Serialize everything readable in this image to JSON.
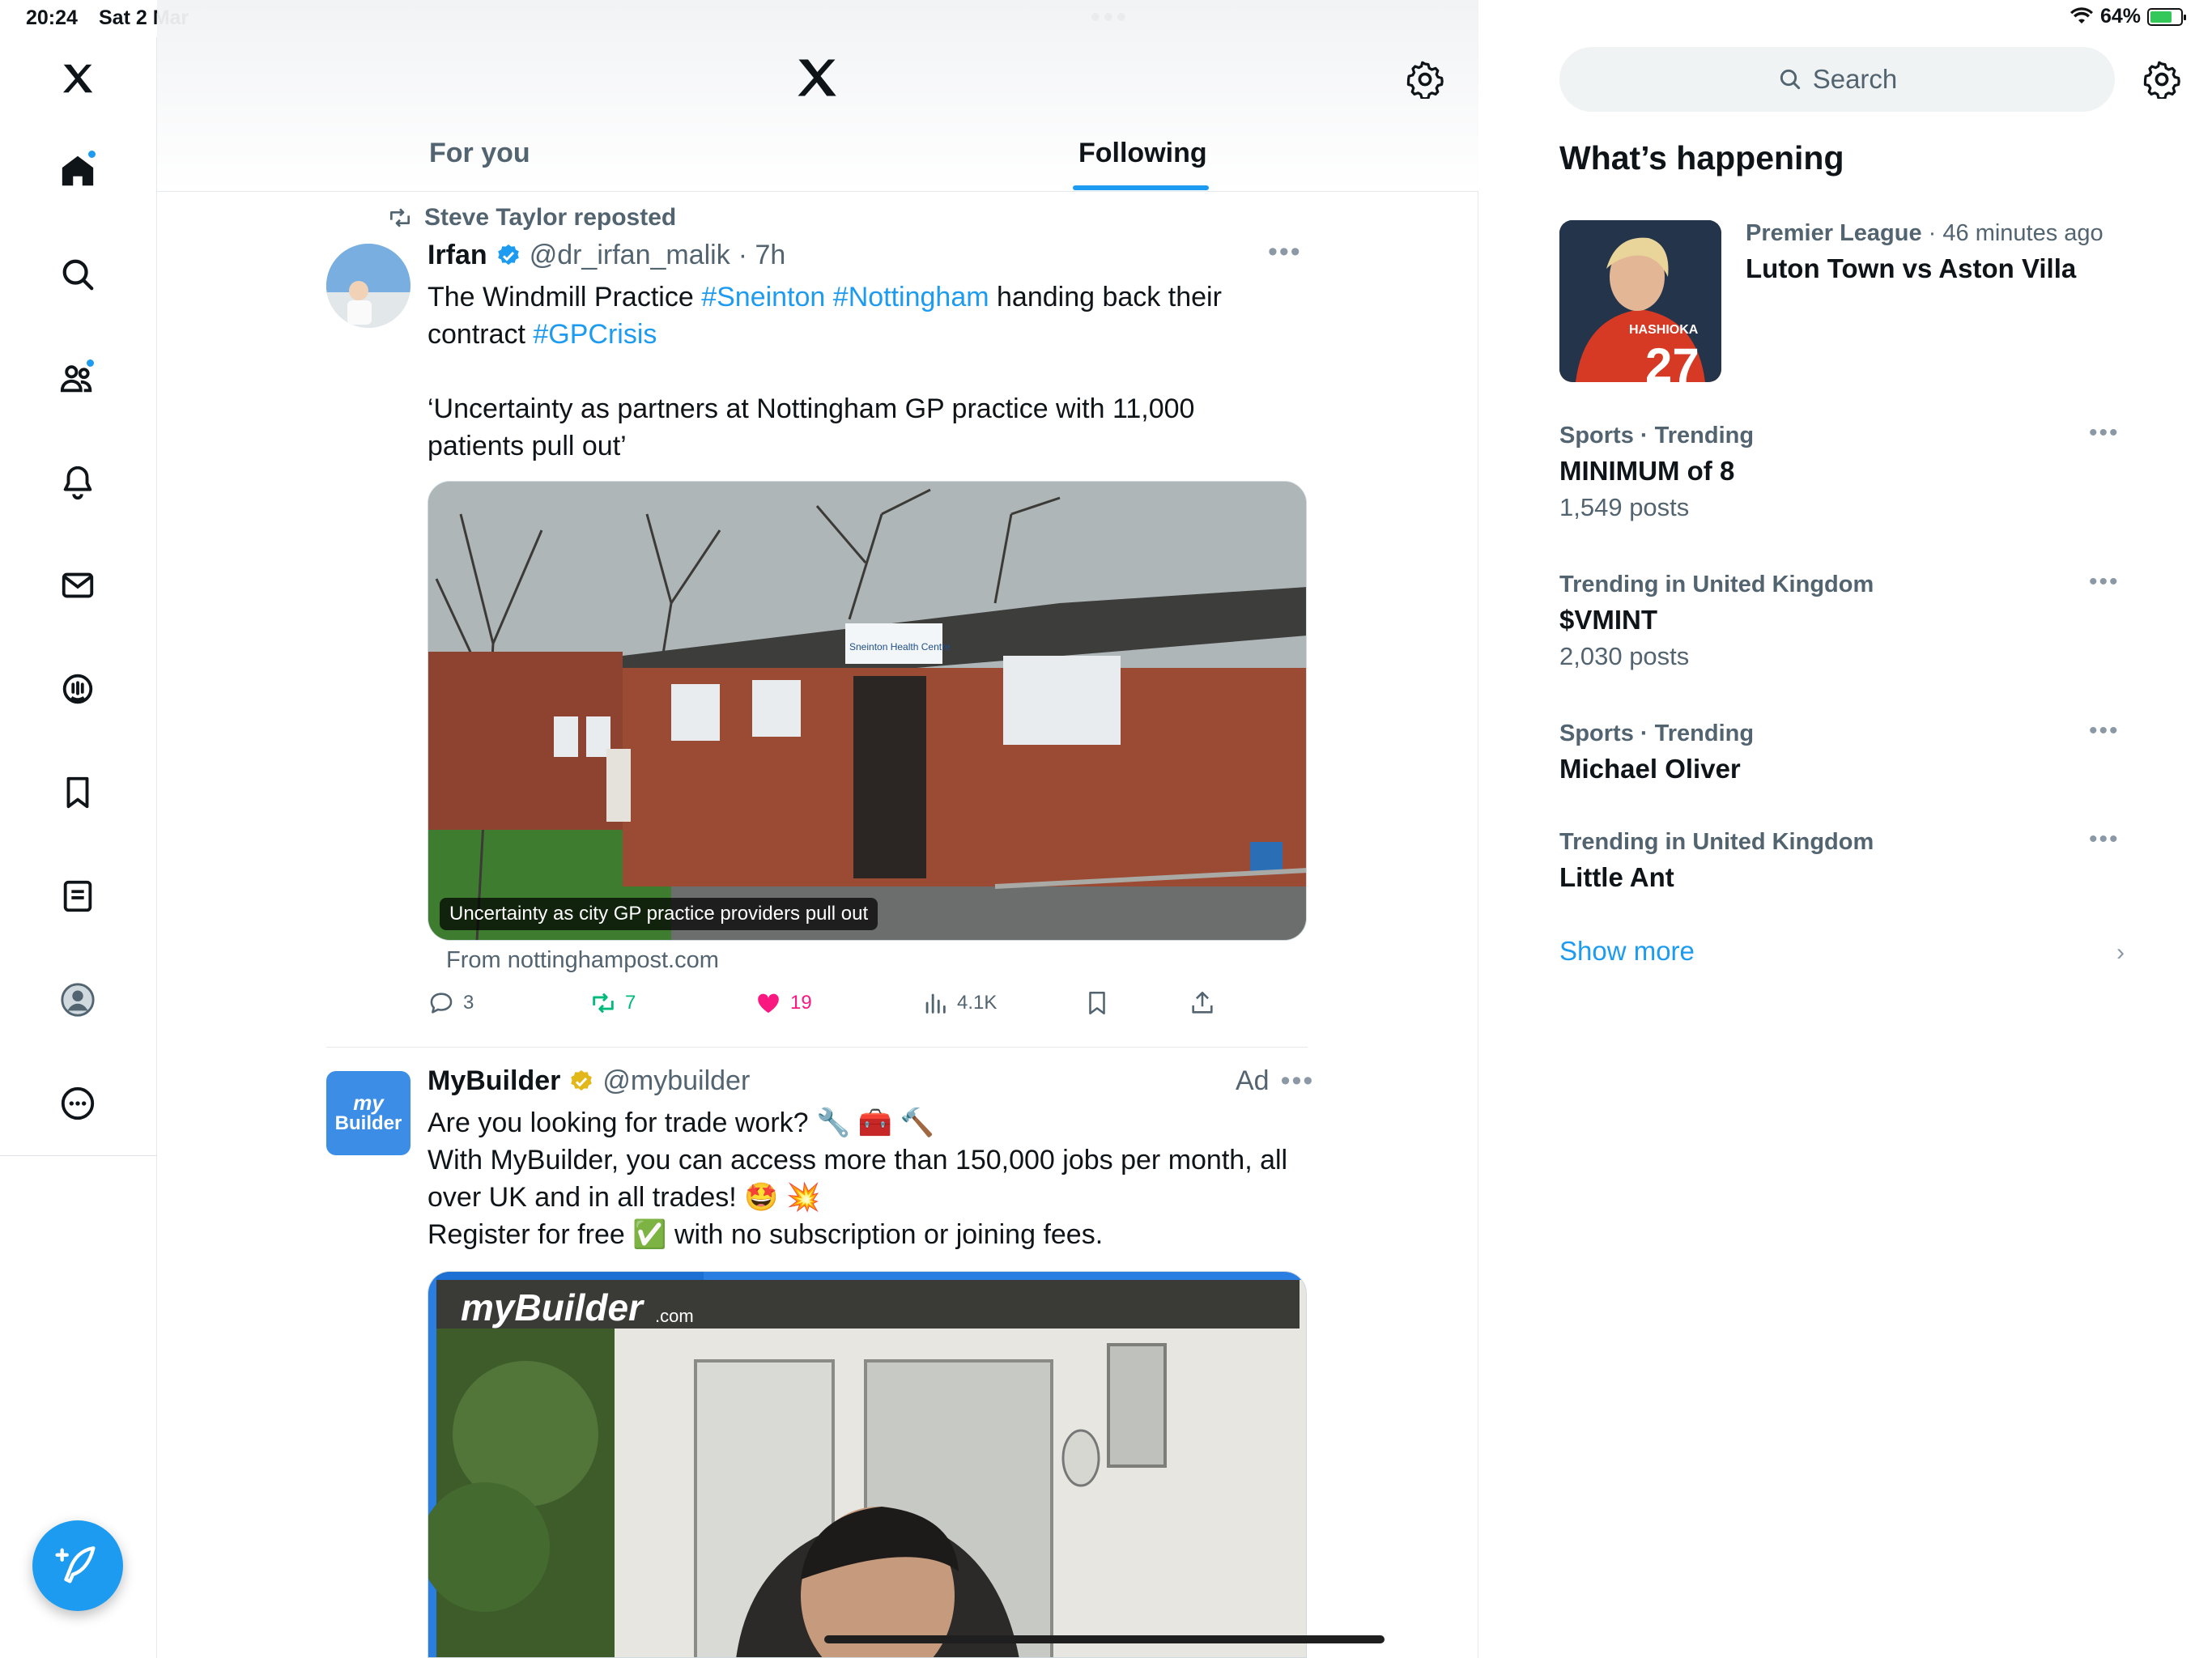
{
  "status_bar": {
    "time": "20:24",
    "date": "Sat 2 Mar",
    "battery": "64%",
    "battery_level": 0.64
  },
  "header": {
    "tabs": [
      {
        "label": "For you",
        "active": false
      },
      {
        "label": "Following",
        "active": true
      }
    ]
  },
  "tweet1": {
    "repost_label": "Steve Taylor reposted",
    "name": "Irfan",
    "handle": "@dr_irfan_malik",
    "time": "· 7h",
    "text_a": "The Windmill Practice ",
    "tag1": "#Sneinton",
    "tag2": "#Nottingham",
    "text_b": " handing back their contract ",
    "tag3": "#GPCrisis",
    "quote": "‘Uncertainty as partners at Nottingham GP practice with 11,000 patients pull out’",
    "media_caption": "Uncertainty as city GP practice providers pull out",
    "sign_text": "Sneinton Health Centre",
    "source": "From nottinghampost.com",
    "stats": {
      "replies": "3",
      "reposts": "7",
      "likes": "19",
      "views": "4.1K"
    }
  },
  "tweet2": {
    "name": "MyBuilder",
    "handle": "@mybuilder",
    "ad_label": "Ad",
    "avatar_line1": "my",
    "avatar_line2": "Builder",
    "line1": "Are you looking for trade work? 🔧 🧰 🔨",
    "line2": "With MyBuilder, you can access more than 150,000 jobs per month, all over UK and in all trades! 🤩 💥",
    "line3": "Register for free ✅ with no subscription or joining fees.",
    "media_logo": "myBuilder",
    "media_logo_suffix": ".com"
  },
  "right": {
    "search_placeholder": "Search",
    "title": "What’s happening",
    "featured": {
      "category": "Premier League",
      "time": " · 46 minutes ago",
      "title": "Luton Town vs Aston Villa",
      "shirt_name": "HASHIOKA",
      "shirt_number": "27"
    },
    "trends": [
      {
        "meta": "Sports · Trending",
        "title": "MINIMUM of 8",
        "count": "1,549 posts"
      },
      {
        "meta": "Trending in United Kingdom",
        "title": "$VMINT",
        "count": "2,030 posts"
      },
      {
        "meta": "Sports · Trending",
        "title": "Michael Oliver",
        "count": ""
      },
      {
        "meta": "Trending in United Kingdom",
        "title": "Little Ant",
        "count": ""
      }
    ],
    "show_more": "Show more"
  },
  "colors": {
    "accent": "#1d9bf0",
    "like": "#f91880",
    "repost": "#00ba7c",
    "text": "#0f1419",
    "muted": "#536471"
  },
  "icons": [
    "x-logo-icon",
    "home-icon",
    "search-icon",
    "communities-icon",
    "notifications-icon",
    "messages-icon",
    "grok-icon",
    "bookmarks-icon",
    "lists-icon",
    "profile-icon",
    "more-icon",
    "compose-icon",
    "settings-icon",
    "reply-icon",
    "repost-icon",
    "like-icon",
    "views-icon",
    "bookmark-icon",
    "share-icon",
    "verified-icon",
    "chevron-right-icon"
  ]
}
